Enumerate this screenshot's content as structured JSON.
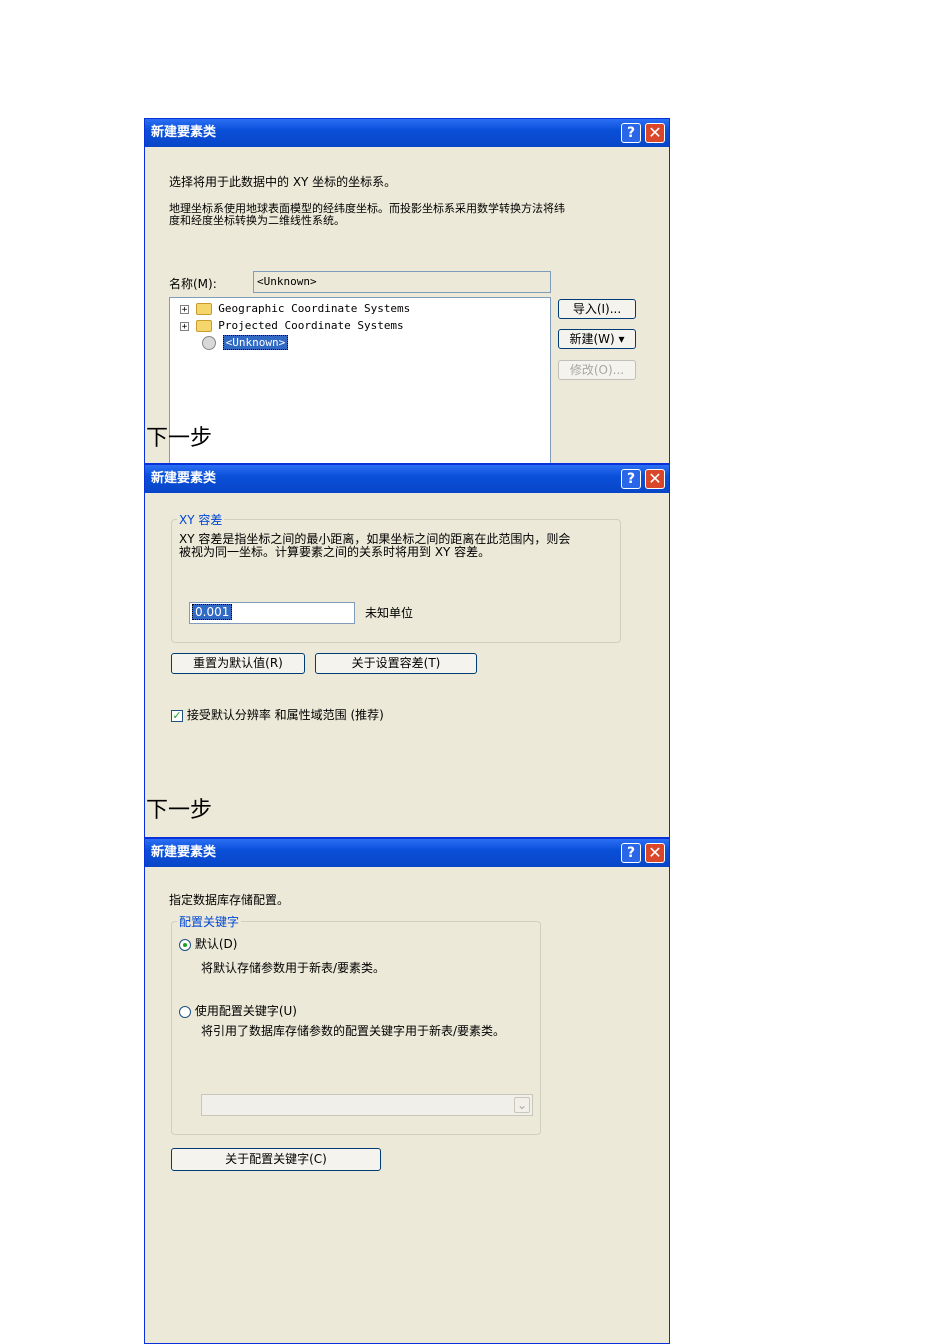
{
  "dialog1": {
    "title": "新建要素类",
    "help_glyph": "?",
    "close_glyph": "✕",
    "intro": "选择将用于此数据中的 XY 坐标的坐标系。",
    "desc_line1": "地理坐标系使用地球表面模型的经纬度坐标。而投影坐标系采用数学转换方法将纬",
    "desc_line2": "度和经度坐标转换为二维线性系统。",
    "name_label": "名称(M):",
    "name_value": "<Unknown>",
    "tree": {
      "expand_glyph": "+",
      "items": [
        "Geographic Coordinate Systems",
        "Projected Coordinate Systems",
        "<Unknown>"
      ]
    },
    "import_button": "导入(I)...",
    "new_button": "新建(W)",
    "new_dropdown_glyph": "▾",
    "modify_button": "修改(O)..."
  },
  "next_label_1": "下一步",
  "dialog2": {
    "title": "新建要素类",
    "help_glyph": "?",
    "close_glyph": "✕",
    "group_label": "XY 容差",
    "desc_line1": "XY 容差是指坐标之间的最小距离，如果坐标之间的距离在此范围内，则会",
    "desc_line2": "被视为同一坐标。计算要素之间的关系时将用到 XY 容差。",
    "tolerance_value": "0.001",
    "unit_label": "未知单位",
    "reset_button": "重置为默认值(R)",
    "about_tolerance_button": "关于设置容差(T)",
    "checkbox_glyph": "✓",
    "accept_checkbox_label": "接受默认分辨率 和属性域范围 (推荐)",
    "accept_checked": true
  },
  "next_label_2": "下一步",
  "dialog3": {
    "title": "新建要素类",
    "help_glyph": "?",
    "close_glyph": "✕",
    "intro": "指定数据库存储配置。",
    "group_label": "配置关键字",
    "default_radio_label": "默认(D)",
    "default_desc": "将默认存储参数用于新表/要素类。",
    "use_keyword_radio_label": "使用配置关键字(U)",
    "use_keyword_desc": "将引用了数据库存储参数的配置关键字用于新表/要素类。",
    "selected_option": "默认(D)",
    "combo_arrow": "⌄",
    "about_keyword_button": "关于配置关键字(C)"
  }
}
